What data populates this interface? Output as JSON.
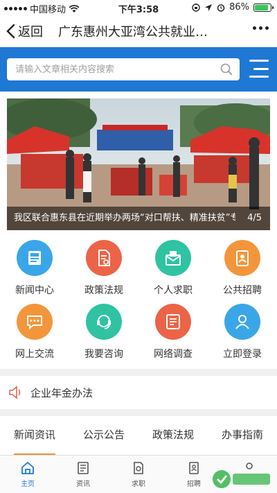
{
  "status_bar": {
    "carrier": "中国移动",
    "time": "下午3:58",
    "battery": "86%",
    "battery_level": 0.86
  },
  "nav": {
    "back_label": "返回",
    "title": "广东惠州大亚湾公共就业…"
  },
  "search": {
    "placeholder": "请输入文章相关内容搜索"
  },
  "banner": {
    "caption": "我区联合惠东县在近期举办两场“对口帮扶、精准扶贫”专…",
    "pager": "4/5"
  },
  "grid": [
    {
      "label": "新闻中心",
      "icon": "news-icon",
      "color": "#3aa6e8"
    },
    {
      "label": "政策法规",
      "icon": "policy-doc-icon",
      "color": "#ec6447"
    },
    {
      "label": "个人求职",
      "icon": "resume-envelope-icon",
      "color": "#2fc3a2"
    },
    {
      "label": "公共招聘",
      "icon": "recruit-clipboard-icon",
      "color": "#f3963b"
    },
    {
      "label": "网上交流",
      "icon": "chat-icon",
      "color": "#f3963b"
    },
    {
      "label": "我要咨询",
      "icon": "headset-icon",
      "color": "#2fc3a2"
    },
    {
      "label": "网络调查",
      "icon": "survey-icon",
      "color": "#ec6447"
    },
    {
      "label": "立即登录",
      "icon": "user-icon",
      "color": "#3aa6e8"
    }
  ],
  "notice": {
    "label": "企业年金办法",
    "icon": "speaker-icon"
  },
  "tabs": [
    {
      "label": "新闻资讯",
      "active": true
    },
    {
      "label": "公示公告",
      "active": false
    },
    {
      "label": "政策法规",
      "active": false
    },
    {
      "label": "办事指南",
      "active": false
    }
  ],
  "tabbar": [
    {
      "label": "主页",
      "icon": "home-icon",
      "active": true
    },
    {
      "label": "资讯",
      "icon": "news-doc-icon",
      "active": false
    },
    {
      "label": "求职",
      "icon": "jobseek-icon",
      "active": false
    },
    {
      "label": "招聘",
      "icon": "recruit-icon",
      "active": false
    },
    {
      "label": "",
      "icon": "profile-icon",
      "active": false
    }
  ],
  "colors": {
    "brand_blue": "#1e78d4",
    "tab_underline": "#e8943a"
  }
}
